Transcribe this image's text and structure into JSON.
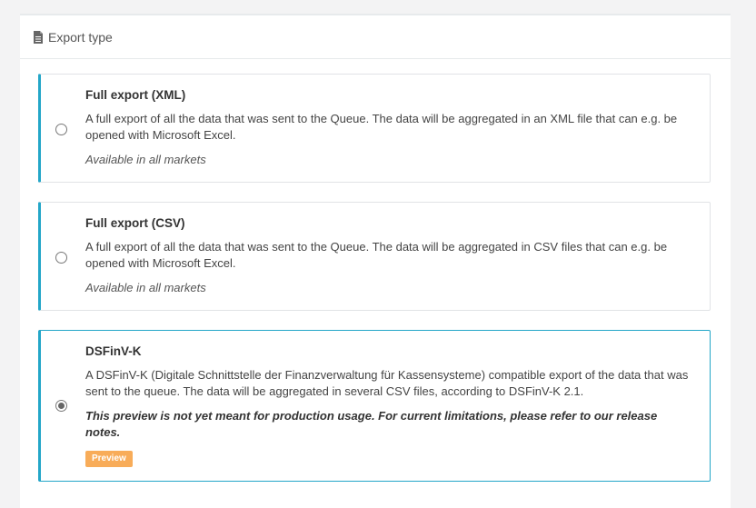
{
  "header": {
    "icon": "document-icon",
    "title": "Export type"
  },
  "options": [
    {
      "title": "Full export (XML)",
      "description": "A full export of all the data that was sent to the Queue. The data will be aggregated in an XML file that can e.g. be opened with Microsoft Excel.",
      "availability": "Available in all markets",
      "selected": false
    },
    {
      "title": "Full export (CSV)",
      "description": "A full export of all the data that was sent to the Queue. The data will be aggregated in CSV files that can e.g. be opened with Microsoft Excel.",
      "availability": "Available in all markets",
      "selected": false
    },
    {
      "title": "DSFinV-K",
      "description": "A DSFinV-K (Digitale Schnittstelle der Finanzverwaltung für Kassensysteme) compatible export of the data that was sent to the queue. The data will be aggregated in several CSV files, according to DSFinV-K 2.1.",
      "warning": "This preview is not yet meant for production usage. For current limitations, please refer to our release notes.",
      "badge": "Preview",
      "selected": true
    }
  ],
  "colors": {
    "accent": "#23a6c8",
    "badge": "#f8ac59"
  }
}
